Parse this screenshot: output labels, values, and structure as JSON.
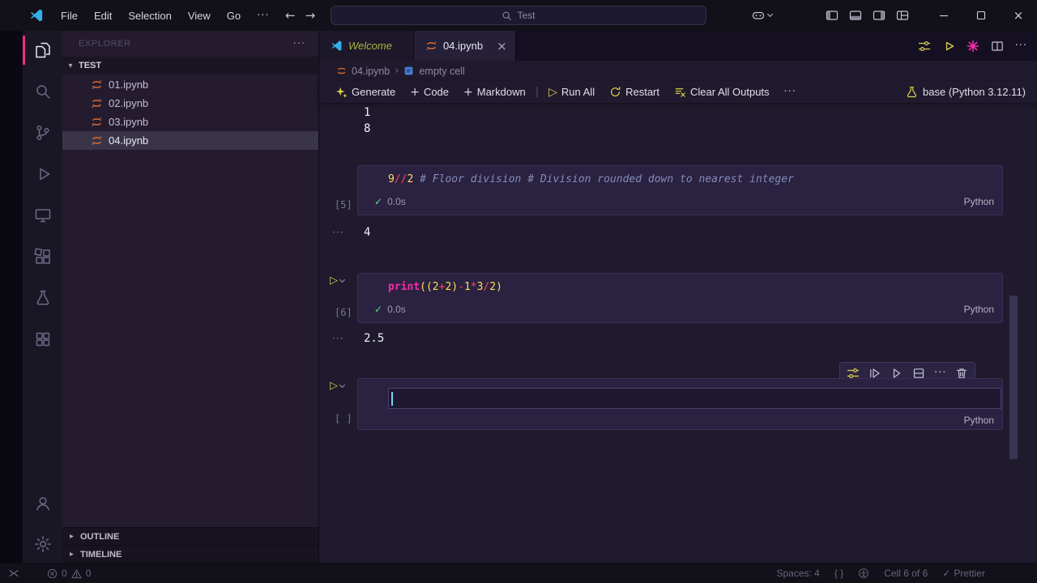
{
  "colors": {
    "accent_pink": "#f22e7f",
    "icon_yellow": "#ded14f",
    "icon_magenta": "#f92aad",
    "success_green": "#5fd78f",
    "jupyter_orange": "#e0692a",
    "vscode_blue": "#33aee6",
    "cursor_blue": "#74d4f4"
  },
  "glyphs": {
    "ellipsis": "···",
    "back_arrow": "←",
    "forward_arrow": "→",
    "run_triangle": "▷",
    "check": "✓",
    "close": "×",
    "plus": "+",
    "pipe": "|",
    "chevron_down_small": "▾",
    "chevron_right_small": "▸",
    "breadcrumb_separator": "›"
  },
  "title_bar": {
    "menus": [
      "File",
      "Edit",
      "Selection",
      "View",
      "Go"
    ],
    "command_center_text": "Test"
  },
  "tabs": [
    {
      "label": "Welcome"
    },
    {
      "label": "04.ipynb"
    }
  ],
  "breadcrumb": {
    "file": "04.ipynb",
    "cell": "empty cell"
  },
  "notebook_toolbar": {
    "generate": "Generate",
    "code": "Code",
    "markdown": "Markdown",
    "run_all": "Run All",
    "restart": "Restart",
    "clear_all_outputs": "Clear All Outputs",
    "kernel": "base (Python 3.12.11)"
  },
  "sidebar": {
    "header": "EXPLORER",
    "section": "TEST",
    "files": [
      "01.ipynb",
      "02.ipynb",
      "03.ipynb",
      "04.ipynb"
    ],
    "outline": "OUTLINE",
    "timeline": "TIMELINE"
  },
  "notebook": {
    "scrolled_output_lines": [
      "1",
      "8"
    ],
    "cells": [
      {
        "execution_label": "[5]",
        "code_tokens": [
          {
            "text": "9",
            "type": "num"
          },
          {
            "text": "//",
            "type": "op"
          },
          {
            "text": "2",
            "type": "num"
          },
          {
            "text": " ",
            "type": "plain"
          },
          {
            "text": "# Floor division # Division rounded down to nearest integer",
            "type": "comment"
          }
        ],
        "duration": "0.0s",
        "language": "Python",
        "output": "4"
      },
      {
        "execution_label": "[6]",
        "code_tokens": [
          {
            "text": "print",
            "type": "func"
          },
          {
            "text": "((",
            "type": "paren"
          },
          {
            "text": "2",
            "type": "num"
          },
          {
            "text": "+",
            "type": "op"
          },
          {
            "text": "2",
            "type": "num"
          },
          {
            "text": ")",
            "type": "paren"
          },
          {
            "text": "-",
            "type": "op"
          },
          {
            "text": "1",
            "type": "num"
          },
          {
            "text": "*",
            "type": "op"
          },
          {
            "text": "3",
            "type": "num"
          },
          {
            "text": "/",
            "type": "op"
          },
          {
            "text": "2",
            "type": "num"
          },
          {
            "text": ")",
            "type": "paren"
          }
        ],
        "duration": "0.0s",
        "language": "Python",
        "output": "2.5"
      },
      {
        "execution_label": "[ ]",
        "language": "Python"
      }
    ]
  },
  "status_bar": {
    "errors": "0",
    "warnings": "0",
    "spaces": "Spaces: 4",
    "braces": "{ }",
    "cell_position": "Cell 6 of 6",
    "formatter": "Prettier"
  }
}
